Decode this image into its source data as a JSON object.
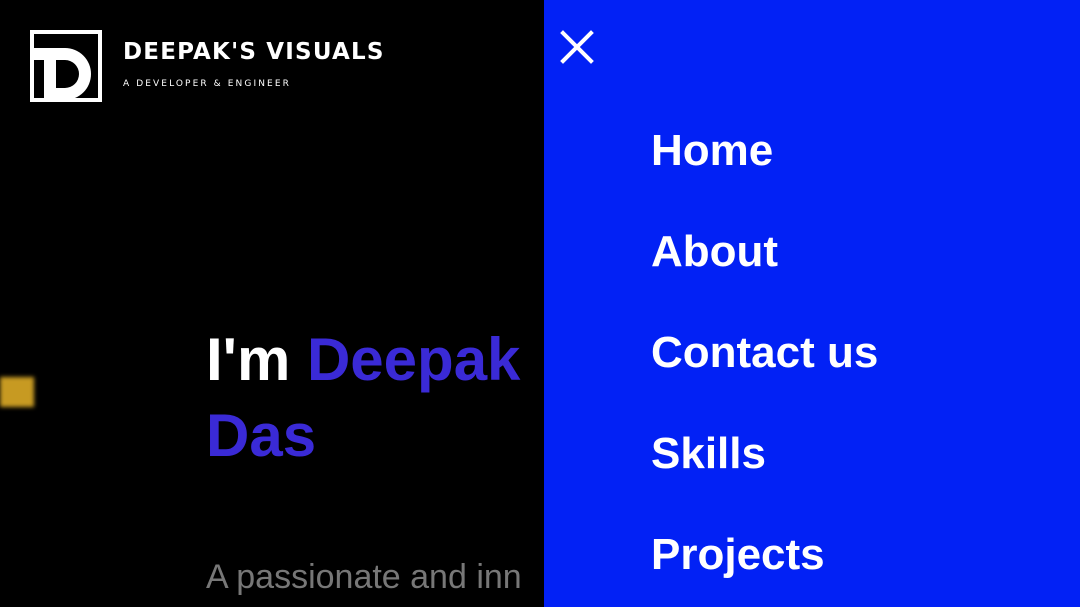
{
  "brand": {
    "name": "DEEPAK'S VISUALS",
    "tagline": "A DEVELOPER & ENGINEER",
    "logo_icon": "d-monogram-logo"
  },
  "hero": {
    "intro": "I'm ",
    "name": "Deepak Das",
    "description": "A passionate and inn"
  },
  "nav": {
    "close_icon": "close-icon",
    "items": [
      {
        "label": "Home"
      },
      {
        "label": "About"
      },
      {
        "label": "Contact us"
      },
      {
        "label": "Skills"
      },
      {
        "label": "Projects"
      }
    ]
  },
  "colors": {
    "background": "#000000",
    "nav_panel": "#0221f5",
    "accent_name": "#3a2ad6",
    "description_text": "#777777",
    "decor_yellow": "#c79a22"
  }
}
